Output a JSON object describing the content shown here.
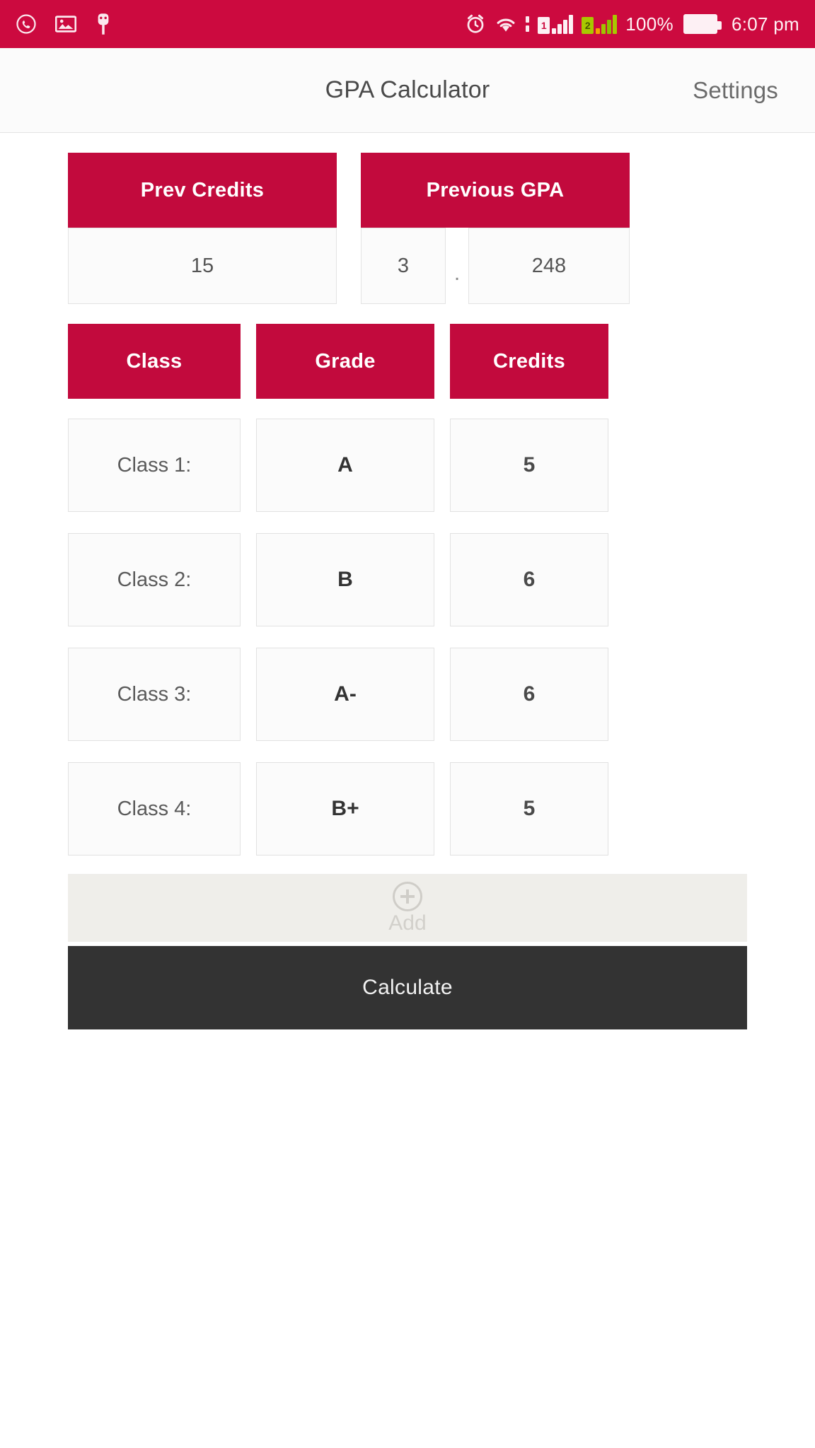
{
  "status_bar": {
    "background": "#cc0a3f",
    "left_icons": [
      "whatsapp-icon",
      "image-icon",
      "usb-icon"
    ],
    "right_icons": [
      "alarm-icon",
      "wifi-icon",
      "vibrate-icon",
      "signal-sim1-icon",
      "signal-sim2-icon"
    ],
    "sim1_label": "1",
    "sim2_label": "2",
    "battery_percent": "100%",
    "battery_icon": "battery-full-icon",
    "time": "6:07 pm"
  },
  "header": {
    "title": "GPA Calculator",
    "settings_label": "Settings"
  },
  "previous": {
    "credits_label": "Prev Credits",
    "credits_value": "15",
    "gpa_label": "Previous GPA",
    "gpa_integer": "3",
    "gpa_separator": ".",
    "gpa_decimal": "248"
  },
  "table": {
    "headers": {
      "class": "Class",
      "grade": "Grade",
      "credits": "Credits"
    },
    "rows": [
      {
        "class": "Class 1:",
        "grade": "A",
        "credits": "5"
      },
      {
        "class": "Class 2:",
        "grade": "B",
        "credits": "6"
      },
      {
        "class": "Class 3:",
        "grade": "A-",
        "credits": "6"
      },
      {
        "class": "Class 4:",
        "grade": "B+",
        "credits": "5"
      }
    ]
  },
  "actions": {
    "add_label": "Add",
    "add_icon": "plus-circle-icon",
    "calculate_label": "Calculate"
  },
  "colors": {
    "accent": "#c20a3d",
    "status_bar": "#cc0a3f",
    "calculate_button": "#333333",
    "field_background": "#fbfbfb"
  }
}
